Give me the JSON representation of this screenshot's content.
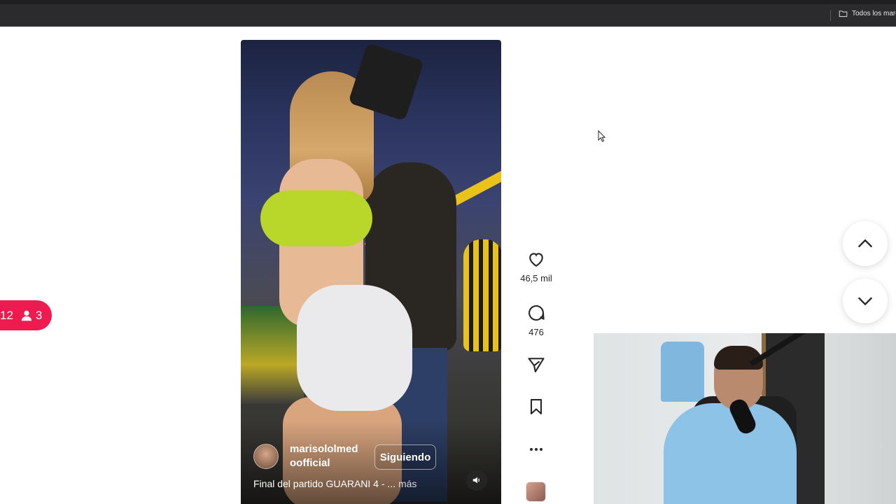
{
  "browser": {
    "bookmarks_all_label": "Todos los marcadores"
  },
  "post": {
    "author": "marisololmed oofficial",
    "follow_label": "Siguiendo",
    "caption": "Final del partido GUARANI 4 - ...",
    "more_label": "más",
    "likes": "46,5 mil",
    "comments": "476"
  },
  "overlay": {
    "notif_count_a": "12",
    "notif_count_b": "3"
  },
  "icons": {
    "like": "heart-icon",
    "comment": "comment-icon",
    "share": "send-icon",
    "save": "bookmark-icon",
    "more": "more-options-icon",
    "mute": "volume-icon",
    "up": "chevron-up-icon",
    "down": "chevron-down-icon",
    "folder": "folder-icon",
    "user": "user-icon"
  },
  "colors": {
    "notif_bg": "#ed1b4f",
    "topbar_bg": "#2b2b2d"
  }
}
